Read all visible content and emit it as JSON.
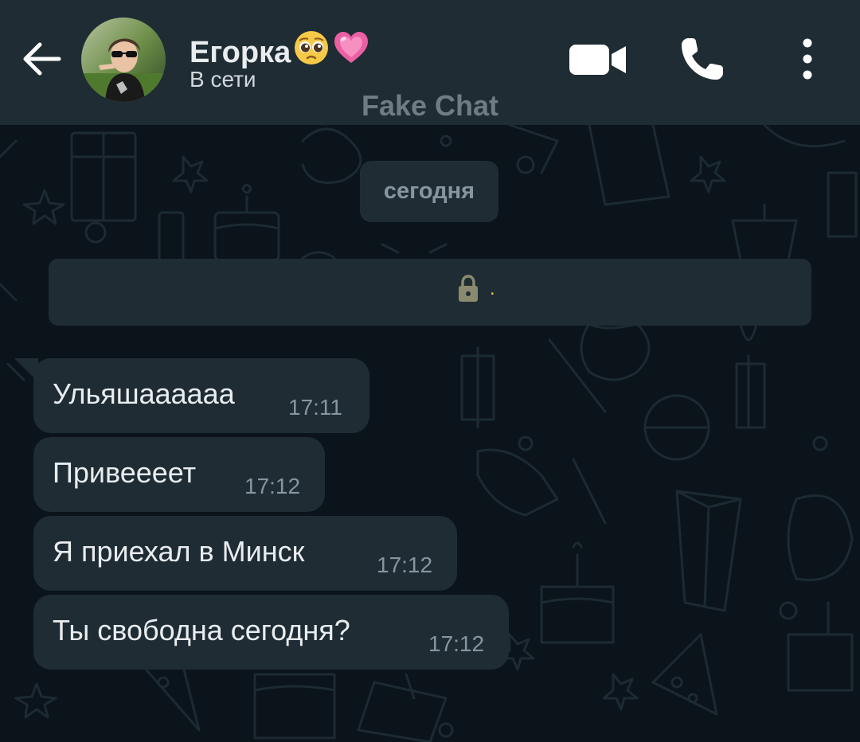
{
  "header": {
    "contact_name": "Егорка",
    "contact_status": "В сети",
    "watermark": "Fake Chat",
    "back_icon": "arrow-left-icon",
    "video_icon": "video-camera-icon",
    "call_icon": "phone-icon",
    "menu_icon": "more-vertical-icon",
    "name_emojis": [
      "pleading-face-emoji",
      "growing-heart-emoji"
    ]
  },
  "chat": {
    "date_chip": "сегодня",
    "system_banner": {
      "icon": "lock-icon",
      "text": "."
    },
    "messages": [
      {
        "text": "Ульяшаааааа",
        "time": "17:11"
      },
      {
        "text": "Привеееет",
        "time": "17:12"
      },
      {
        "text": "Я приехал в Минск",
        "time": "17:12"
      },
      {
        "text": "Ты свободна сегодня?",
        "time": "17:12"
      }
    ]
  },
  "colors": {
    "header_bg": "#1f2c34",
    "chat_bg": "#0b141a",
    "bubble_bg": "#1f2c34",
    "text_primary": "#e9edef",
    "text_secondary": "#8696a0",
    "banner_accent": "#f5c451"
  }
}
